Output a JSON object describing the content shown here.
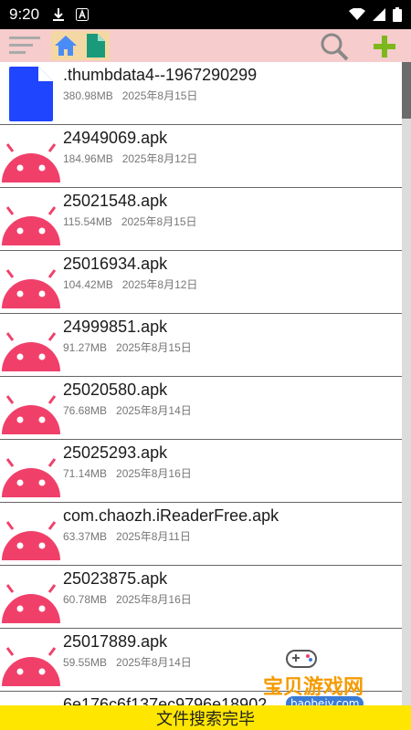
{
  "status": {
    "time": "9:20"
  },
  "files": [
    {
      "name": ".thumbdata4--1967290299",
      "size": "380.98MB",
      "date": "2025年8月15日",
      "icon": "file-icon"
    },
    {
      "name": "24949069.apk",
      "size": "184.96MB",
      "date": "2025年8月12日",
      "icon": "android-icon"
    },
    {
      "name": "25021548.apk",
      "size": "115.54MB",
      "date": "2025年8月15日",
      "icon": "android-icon"
    },
    {
      "name": "25016934.apk",
      "size": "104.42MB",
      "date": "2025年8月12日",
      "icon": "android-icon"
    },
    {
      "name": "24999851.apk",
      "size": "91.27MB",
      "date": "2025年8月15日",
      "icon": "android-icon"
    },
    {
      "name": "25020580.apk",
      "size": "76.68MB",
      "date": "2025年8月14日",
      "icon": "android-icon"
    },
    {
      "name": "25025293.apk",
      "size": "71.14MB",
      "date": "2025年8月16日",
      "icon": "android-icon"
    },
    {
      "name": "com.chaozh.iReaderFree.apk",
      "size": "63.37MB",
      "date": "2025年8月11日",
      "icon": "android-icon"
    },
    {
      "name": "25023875.apk",
      "size": "60.78MB",
      "date": "2025年8月16日",
      "icon": "android-icon"
    },
    {
      "name": "25017889.apk",
      "size": "59.55MB",
      "date": "2025年8月14日",
      "icon": "android-icon"
    },
    {
      "name": "6e176c6f137ec9796e18902",
      "size": "",
      "date": "",
      "icon": "archive-icon"
    }
  ],
  "bottom_bar": {
    "text": "文件搜索完毕"
  },
  "watermark": {
    "title": "宝贝游戏网",
    "url": "baobeiy.com"
  },
  "colors": {
    "toolbar": "#f6cccc",
    "android": "#f0406a",
    "file_blue": "#1f45ff",
    "bottom_bar": "#ffe600"
  }
}
